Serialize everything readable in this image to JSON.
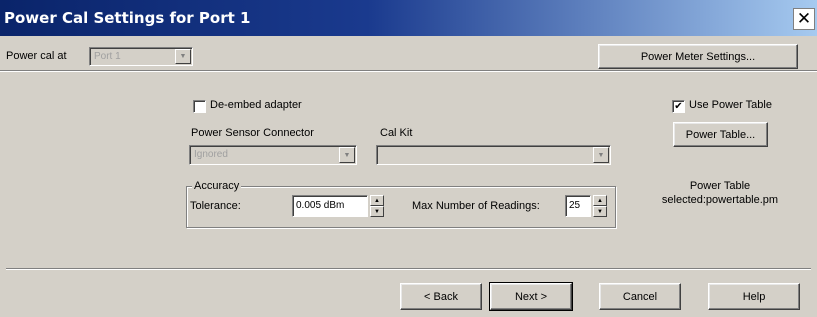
{
  "window": {
    "title": "Power Cal Settings for Port 1",
    "close_glyph": "✕"
  },
  "toolbar": {
    "power_cal_at_label": "Power cal at",
    "power_cal_at_value": "Port 1",
    "power_meter_settings_label": "Power Meter Settings..."
  },
  "options": {
    "deembed_label": "De-embed adapter",
    "deembed_checked": false,
    "use_power_table_label": "Use Power Table",
    "use_power_table_checked": true,
    "power_table_button": "Power Table...",
    "power_sensor_connector_label": "Power Sensor Connector",
    "power_sensor_connector_value": "Ignored",
    "cal_kit_label": "Cal Kit",
    "cal_kit_value": ""
  },
  "accuracy": {
    "group_label": "Accuracy",
    "tolerance_label": "Tolerance:",
    "tolerance_value": "0.005 dBm",
    "max_readings_label": "Max Number of Readings:",
    "max_readings_value": "25"
  },
  "power_table_info": {
    "line1": "Power Table",
    "line2": "selected:powertable.pm"
  },
  "footer": {
    "back": "< Back",
    "next": "Next >",
    "cancel": "Cancel",
    "help": "Help"
  }
}
